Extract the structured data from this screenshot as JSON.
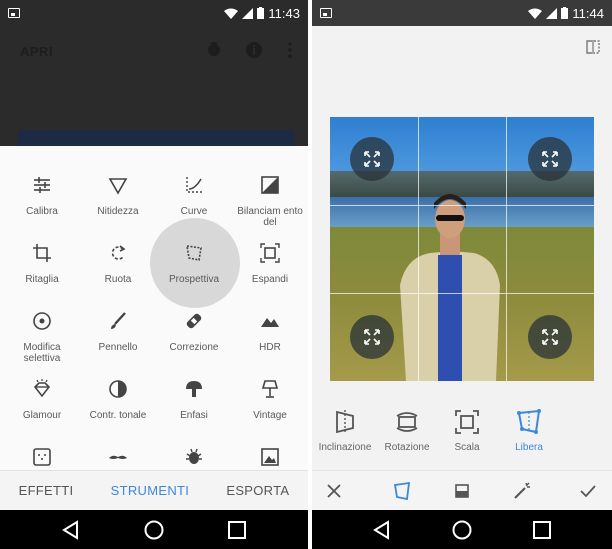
{
  "left": {
    "status": {
      "time": "11:43"
    },
    "topbar": {
      "open_label": "APRI"
    },
    "tools": [
      {
        "label": "Calibra",
        "icon": "sliders-icon"
      },
      {
        "label": "Nitidezza",
        "icon": "triangle-icon"
      },
      {
        "label": "Curve",
        "icon": "curve-icon"
      },
      {
        "label": "Bilanciam ento del",
        "icon": "white-balance-icon"
      },
      {
        "label": "Ritaglia",
        "icon": "crop-icon"
      },
      {
        "label": "Ruota",
        "icon": "rotate-icon"
      },
      {
        "label": "Prospettiva",
        "icon": "perspective-icon"
      },
      {
        "label": "Espandi",
        "icon": "expand-icon"
      },
      {
        "label": "Modifica selettiva",
        "icon": "target-icon"
      },
      {
        "label": "Pennello",
        "icon": "brush-icon"
      },
      {
        "label": "Correzione",
        "icon": "healing-icon"
      },
      {
        "label": "HDR",
        "icon": "mountain-icon"
      },
      {
        "label": "Glamour",
        "icon": "diamond-icon"
      },
      {
        "label": "Contr. tonale",
        "icon": "tonal-icon"
      },
      {
        "label": "Enfasi",
        "icon": "mushroom-icon"
      },
      {
        "label": "Vintage",
        "icon": "lamp-icon"
      },
      {
        "label": "",
        "icon": "grainy-icon"
      },
      {
        "label": "",
        "icon": "mustache-icon"
      },
      {
        "label": "",
        "icon": "bug-icon"
      },
      {
        "label": "",
        "icon": "noir-icon"
      }
    ],
    "tabs": [
      {
        "label": "EFFETTI",
        "active": false
      },
      {
        "label": "STRUMENTI",
        "active": true
      },
      {
        "label": "ESPORTA",
        "active": false
      }
    ]
  },
  "right": {
    "status": {
      "time": "11:44"
    },
    "perspective_tools": [
      {
        "label": "Inclinazione",
        "icon": "tilt-icon",
        "active": false
      },
      {
        "label": "Rotazione",
        "icon": "rotation-icon",
        "active": false
      },
      {
        "label": "Scala",
        "icon": "scale-icon",
        "active": false
      },
      {
        "label": "Libera",
        "icon": "free-perspective-icon",
        "active": true
      }
    ],
    "actions": [
      "close-icon",
      "perspective-mode-icon",
      "fill-icon",
      "auto-wand-icon",
      "check-icon"
    ]
  },
  "colors": {
    "accent": "#3d88d8",
    "dark_header": "#2b2b2b",
    "nav_bar": "#000000"
  }
}
